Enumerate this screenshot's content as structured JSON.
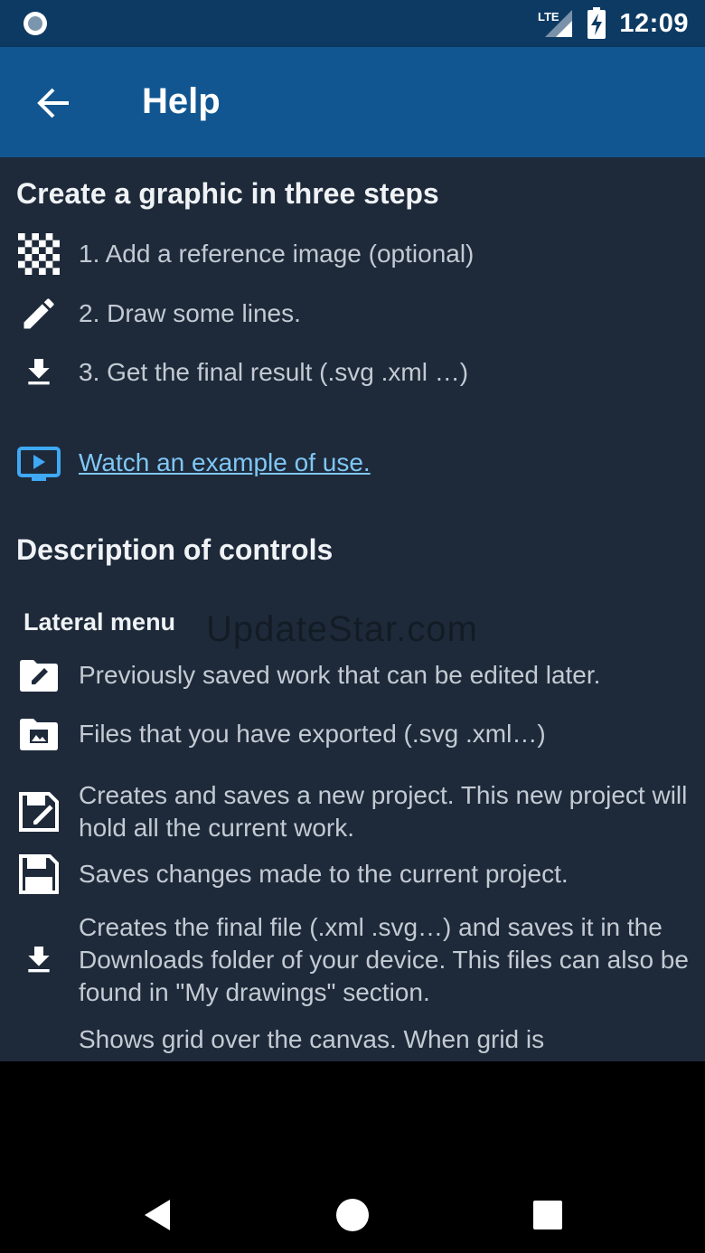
{
  "status_bar": {
    "network": "LTE",
    "time": "12:09"
  },
  "app_bar": {
    "title": "Help",
    "back_icon": "arrow-left-icon"
  },
  "steps": {
    "heading": "Create a graphic in three steps",
    "items": [
      {
        "icon": "checkerboard-icon",
        "text": "1. Add a reference image (optional)"
      },
      {
        "icon": "pencil-icon",
        "text": "2. Draw some lines."
      },
      {
        "icon": "download-icon",
        "text": "3. Get the final result (.svg .xml …)"
      }
    ]
  },
  "example_link": {
    "icon": "play-video-icon",
    "text": "Watch an example of use."
  },
  "controls": {
    "heading": "Description of controls",
    "lateral_menu": {
      "title": "Lateral menu",
      "items": [
        {
          "icon": "folder-edit-icon",
          "text": "Previously saved work that can be edited later."
        },
        {
          "icon": "folder-image-icon",
          "text": "Files that you have exported (.svg .xml…)"
        },
        {
          "icon": "save-as-icon",
          "text": "Creates and saves a new project. This new project will hold all the current work."
        },
        {
          "icon": "save-icon",
          "text": "Saves changes made to the current project."
        },
        {
          "icon": "download-icon",
          "text": "Creates the final file (.xml .svg…) and saves it in the Downloads folder of your device. This files can also be found in \"My drawings\" section."
        },
        {
          "icon": "grid-icon",
          "text": "Shows grid over the canvas. When grid is"
        }
      ]
    }
  },
  "watermark": "UpdateStar.com",
  "colors": {
    "status_bar": "#0d3a63",
    "app_bar": "#115690",
    "background": "#1e2a3a",
    "link": "#7fc7f5",
    "text": "#c3cad3"
  }
}
